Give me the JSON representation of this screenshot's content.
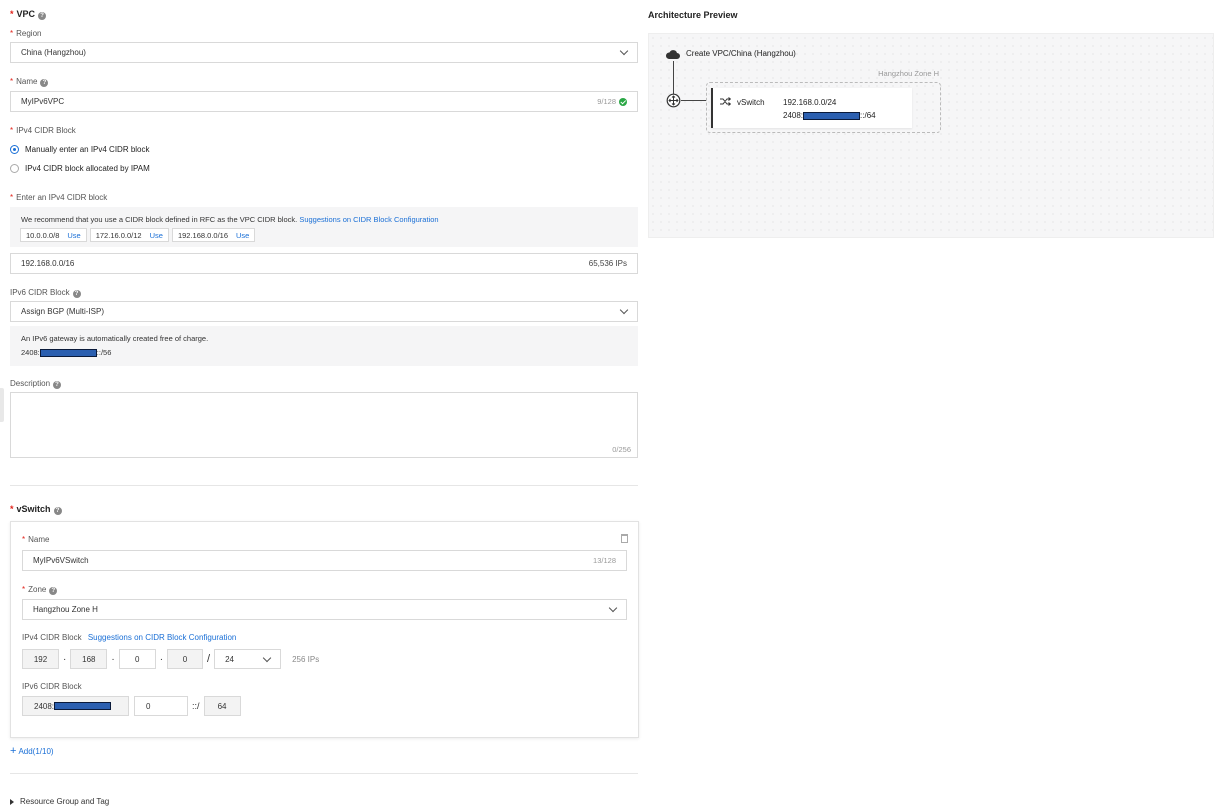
{
  "vpc": {
    "title": "VPC",
    "region_label": "Region",
    "region_value": "China (Hangzhou)",
    "name_label": "Name",
    "name_value": "MyIPv6VPC",
    "name_counter": "9/128",
    "ipv4_label": "IPv4 CIDR Block",
    "ipv4_option_manual": "Manually enter an IPv4 CIDR block",
    "ipv4_option_ipam": "IPv4 CIDR block allocated by IPAM",
    "enter_label": "Enter an IPv4 CIDR block",
    "recommend_text": "We recommend that you use a CIDR block defined in RFC as the VPC CIDR block.",
    "recommend_link": "Suggestions on CIDR Block Configuration",
    "suggestions": [
      {
        "cidr": "10.0.0.0/8",
        "action": "Use"
      },
      {
        "cidr": "172.16.0.0/12",
        "action": "Use"
      },
      {
        "cidr": "192.168.0.0/16",
        "action": "Use"
      }
    ],
    "cidr_value": "192.168.0.0/16",
    "cidr_ips": "65,536 IPs",
    "ipv6_label": "IPv6 CIDR Block",
    "ipv6_value": "Assign BGP (Multi-ISP)",
    "ipv6_note": "An IPv6 gateway is automatically created free of charge.",
    "ipv6_prefix": "2408:",
    "ipv6_suffix": "::/56",
    "desc_label": "Description",
    "desc_counter": "0/256"
  },
  "vswitch": {
    "title": "vSwitch",
    "name_label": "Name",
    "name_value": "MyIPv6VSwitch",
    "name_counter": "13/128",
    "zone_label": "Zone",
    "zone_value": "Hangzhou Zone H",
    "ipv4_label": "IPv4 CIDR Block",
    "ipv4_link": "Suggestions on CIDR Block Configuration",
    "octets": [
      "192",
      "168",
      "0",
      "0"
    ],
    "mask": "24",
    "ips": "256 IPs",
    "ipv6_label": "IPv6 CIDR Block",
    "ipv6_prefix": "2408:",
    "ipv6_input": "0",
    "ipv6_sep": "::/",
    "ipv6_mask": "64",
    "add_label": "Add(1/10)"
  },
  "resource_group": "Resource Group and Tag",
  "preview": {
    "title": "Architecture Preview",
    "vpc_label": "Create VPC/China (Hangzhou)",
    "zone": "Hangzhou Zone H",
    "vswitch_label": "vSwitch",
    "ipv4": "192.168.0.0/24",
    "ipv6_prefix": "2408:",
    "ipv6_suffix": "::/64"
  },
  "colors": {
    "accent": "#1a6fd6",
    "required": "#e2231a",
    "success": "#2aa745",
    "redaction": "#2b5fb0"
  }
}
